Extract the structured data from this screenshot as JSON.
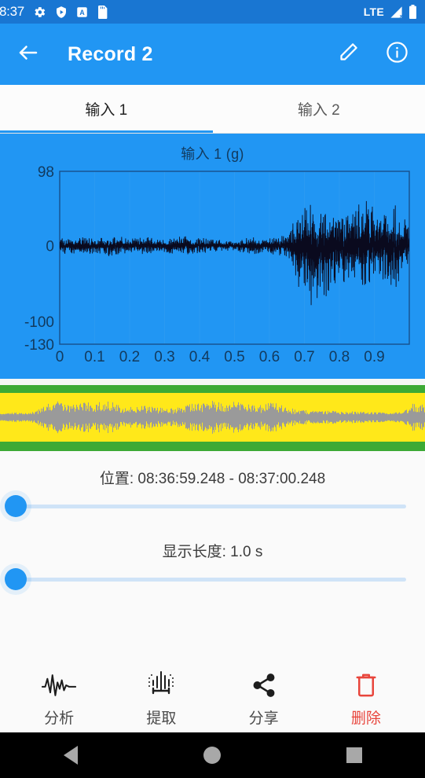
{
  "status_bar": {
    "time": "8:37",
    "left_icons": [
      "gear-icon",
      "shield-play-icon",
      "a-box-icon",
      "sd-card-icon"
    ],
    "network_label": "LTE",
    "right_icons": [
      "signal-no-data-icon",
      "battery-icon"
    ]
  },
  "app_bar": {
    "back_icon": "arrow-left-icon",
    "title": "Record 2",
    "edit_icon": "pencil-icon",
    "info_icon": "info-circle-icon",
    "background": "#2196f3"
  },
  "tabs": [
    {
      "label": "输入 1",
      "active": true
    },
    {
      "label": "输入 2",
      "active": false
    }
  ],
  "chart_data": {
    "type": "line",
    "title": "输入 1 (g)",
    "xlabel": "",
    "ylabel": "g",
    "background": "#2196f3",
    "trace_color": "#0a0a1e",
    "grid": false,
    "xlim": [
      0,
      1.0
    ],
    "ylim": [
      -130,
      98
    ],
    "ytick_labels": [
      "98",
      "0",
      "-100",
      "-130"
    ],
    "ytick_values": [
      98,
      0,
      -100,
      -130
    ],
    "xtick_labels": [
      "0",
      "0.1",
      "0.2",
      "0.3",
      "0.4",
      "0.5",
      "0.6",
      "0.7",
      "0.8",
      "0.9"
    ],
    "xtick_values": [
      0,
      0.1,
      0.2,
      0.3,
      0.4,
      0.5,
      0.6,
      0.7,
      0.8,
      0.9
    ],
    "series": [
      {
        "name": "输入 1",
        "description": "Accelerometer noise trace: low amplitude (±15 g) from 0 to 0.65 s, then a large burst peaking near +98 / -130 g between 0.65 and 1.0 s",
        "envelope_x": [
          0.0,
          0.05,
          0.1,
          0.15,
          0.2,
          0.25,
          0.3,
          0.35,
          0.4,
          0.45,
          0.5,
          0.55,
          0.6,
          0.65,
          0.68,
          0.72,
          0.76,
          0.8,
          0.84,
          0.88,
          0.92,
          0.96,
          1.0
        ],
        "envelope_pos": [
          14,
          18,
          16,
          20,
          15,
          17,
          14,
          19,
          16,
          12,
          10,
          18,
          15,
          22,
          70,
          95,
          80,
          60,
          72,
          88,
          66,
          80,
          40
        ],
        "envelope_neg": [
          -14,
          -20,
          -18,
          -22,
          -16,
          -18,
          -15,
          -20,
          -17,
          -12,
          -10,
          -19,
          -16,
          -24,
          -85,
          -128,
          -105,
          -70,
          -80,
          -95,
          -72,
          -90,
          -45
        ]
      }
    ]
  },
  "overview_waveform": {
    "background": "#ffe81a",
    "border_color": "#3caa35",
    "trace_color": "#9a9a9a",
    "selection_start_fraction": 0.0
  },
  "position": {
    "label": "位置: 08:36:59.248 -  08:37:00.248",
    "slider_value_fraction": 0.0
  },
  "display_length": {
    "label": "显示长度: 1.0 s",
    "slider_value_fraction": 0.0
  },
  "actions": [
    {
      "label": "分析",
      "icon": "waveform-icon",
      "danger": false
    },
    {
      "label": "提取",
      "icon": "extract-icon",
      "danger": false
    },
    {
      "label": "分享",
      "icon": "share-icon",
      "danger": false
    },
    {
      "label": "删除",
      "icon": "trash-icon",
      "danger": true
    }
  ],
  "nav_bar": {
    "back": "nav-back-icon",
    "home": "nav-home-icon",
    "recents": "nav-recents-icon"
  },
  "colors": {
    "accent": "#2196f3",
    "status_bar": "#1976d2",
    "danger": "#e8453c",
    "waveform_yellow": "#ffe81a",
    "waveform_green": "#3caa35"
  }
}
